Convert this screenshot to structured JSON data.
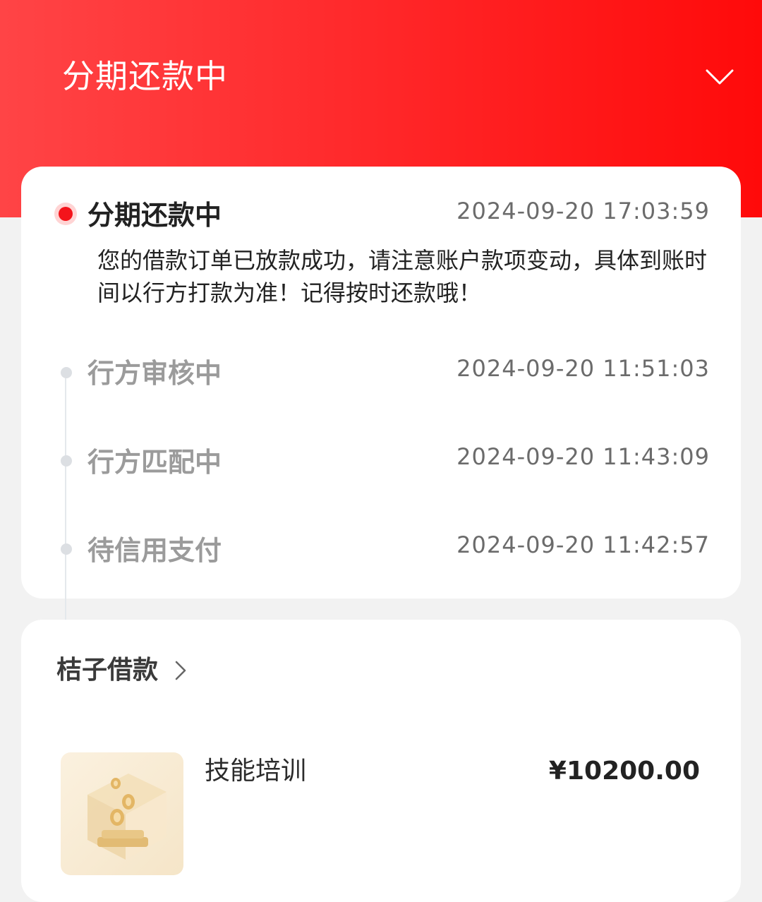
{
  "header": {
    "title": "分期还款中",
    "toggle_icon": "chevron-down-icon",
    "gradient_start": "#ff4446",
    "gradient_end": "#ff0a0a"
  },
  "timeline": {
    "active_color": "#f4141b",
    "steps": [
      {
        "title": "分期还款中",
        "time": "2024-09-20 17:03:59",
        "description": "您的借款订单已放款成功，请注意账户款项变动，具体到账时间以行方打款为准！记得按时还款哦！",
        "active": true
      },
      {
        "title": "行方审核中",
        "time": "2024-09-20 11:51:03",
        "active": false
      },
      {
        "title": "行方匹配中",
        "time": "2024-09-20 11:43:09",
        "active": false
      },
      {
        "title": "待信用支付",
        "time": "2024-09-20 11:42:57",
        "active": false
      }
    ]
  },
  "order": {
    "merchant_name": "桔子借款",
    "merchant_arrow_icon": "chevron-right-icon",
    "product": {
      "name": "技能培训",
      "price": "¥10200.00",
      "thumbnail_icon": "coin-box-icon"
    }
  }
}
